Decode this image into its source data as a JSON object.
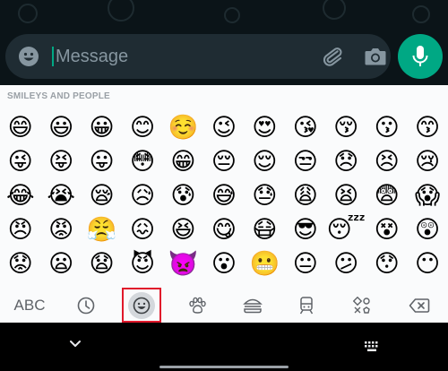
{
  "composer": {
    "placeholder": "Message",
    "icons": [
      "smiley-icon",
      "paperclip-icon",
      "camera-icon",
      "microphone-icon"
    ],
    "accent_color": "#00a884"
  },
  "keyboard": {
    "section_title": "SMILEYS AND PEOPLE",
    "emojis": [
      "😄",
      "😃",
      "😀",
      "😊",
      "☺️",
      "😉",
      "😍",
      "😘",
      "😚",
      "😗",
      "😙",
      "😜",
      "😝",
      "😛",
      "😳",
      "😁",
      "😔",
      "😌",
      "😒",
      "😞",
      "😣",
      "😢",
      "😂",
      "😭",
      "😪",
      "😥",
      "😰",
      "😅",
      "😓",
      "😩",
      "😫",
      "😨",
      "😱",
      "😠",
      "😡",
      "😤",
      "😖",
      "😆",
      "😋",
      "😷",
      "😎",
      "😴",
      "😵",
      "😲",
      "😟",
      "😦",
      "😧",
      "😈",
      "👿",
      "😮",
      "😬",
      "😐",
      "😕",
      "😯",
      "😶"
    ],
    "categories": {
      "abc_label": "ABC",
      "items": [
        "recent-clock-icon",
        "smileys-icon",
        "animals-paw-icon",
        "food-burger-icon",
        "travel-train-icon",
        "symbols-icon",
        "backspace-icon"
      ],
      "selected": "smileys-icon"
    }
  },
  "navigation": {
    "icons": [
      "chevron-down-icon",
      "keyboard-switch-icon",
      "home-indicator"
    ]
  }
}
